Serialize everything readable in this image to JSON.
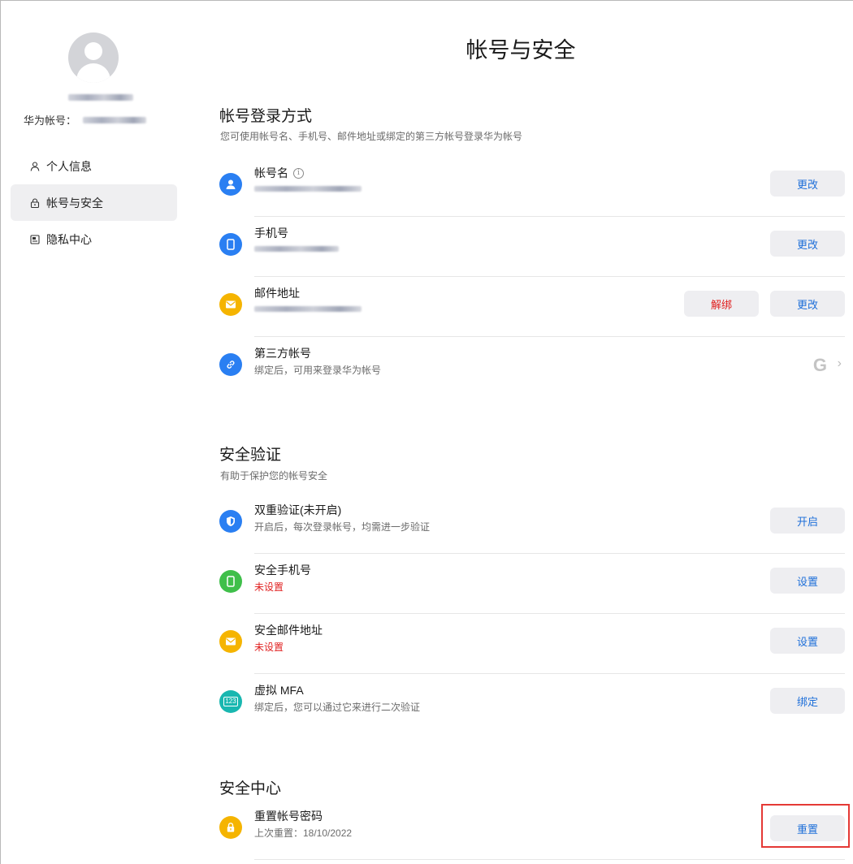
{
  "page": {
    "title": "帐号与安全"
  },
  "profile": {
    "account_label": "华为帐号："
  },
  "nav": [
    {
      "label": "个人信息",
      "icon": "person-icon"
    },
    {
      "label": "帐号与安全",
      "icon": "lock-icon",
      "active": true
    },
    {
      "label": "隐私中心",
      "icon": "privacy-icon"
    }
  ],
  "login_methods": {
    "title": "帐号登录方式",
    "subtitle": "您可使用帐号名、手机号、邮件地址或绑定的第三方帐号登录华为帐号",
    "rows": [
      {
        "label": "帐号名",
        "action": "更改",
        "icon": "user-icon",
        "color": "#2a7ff2"
      },
      {
        "label": "手机号",
        "action": "更改",
        "icon": "phone-icon",
        "color": "#2a7ff2"
      },
      {
        "label": "邮件地址",
        "action": "更改",
        "secondary_action": "解绑",
        "icon": "mail-icon",
        "color": "#f5b400"
      },
      {
        "label": "第三方帐号",
        "subtitle": "绑定后，可用来登录华为帐号",
        "icon": "link-icon",
        "color": "#2a7ff2",
        "provider": "G"
      }
    ]
  },
  "security_verification": {
    "title": "安全验证",
    "subtitle": "有助于保护您的帐号安全",
    "rows": [
      {
        "label": "双重验证(未开启)",
        "subtitle": "开启后，每次登录帐号，均需进一步验证",
        "action": "开启",
        "icon": "shield-icon",
        "color": "#2a7ff2"
      },
      {
        "label": "安全手机号",
        "subtitle": "未设置",
        "action": "设置",
        "icon": "phone-icon",
        "color": "#3fbf4a"
      },
      {
        "label": "安全邮件地址",
        "subtitle": "未设置",
        "action": "设置",
        "icon": "mail-icon",
        "color": "#f5b400"
      },
      {
        "label": "虚拟 MFA",
        "subtitle": "绑定后，您可以通过它来进行二次验证",
        "action": "绑定",
        "icon": "mfa-123-icon",
        "color": "#19b7b0",
        "icon_text": "123"
      }
    ]
  },
  "security_center": {
    "title": "安全中心",
    "rows": [
      {
        "label": "重置帐号密码",
        "subtitle": "上次重置：18/10/2022",
        "action": "重置",
        "icon": "lock-icon",
        "color": "#f5b400"
      }
    ]
  },
  "colors": {
    "accent": "#1e6fd9",
    "danger": "#e02020",
    "button_bg": "#eeeef1"
  }
}
